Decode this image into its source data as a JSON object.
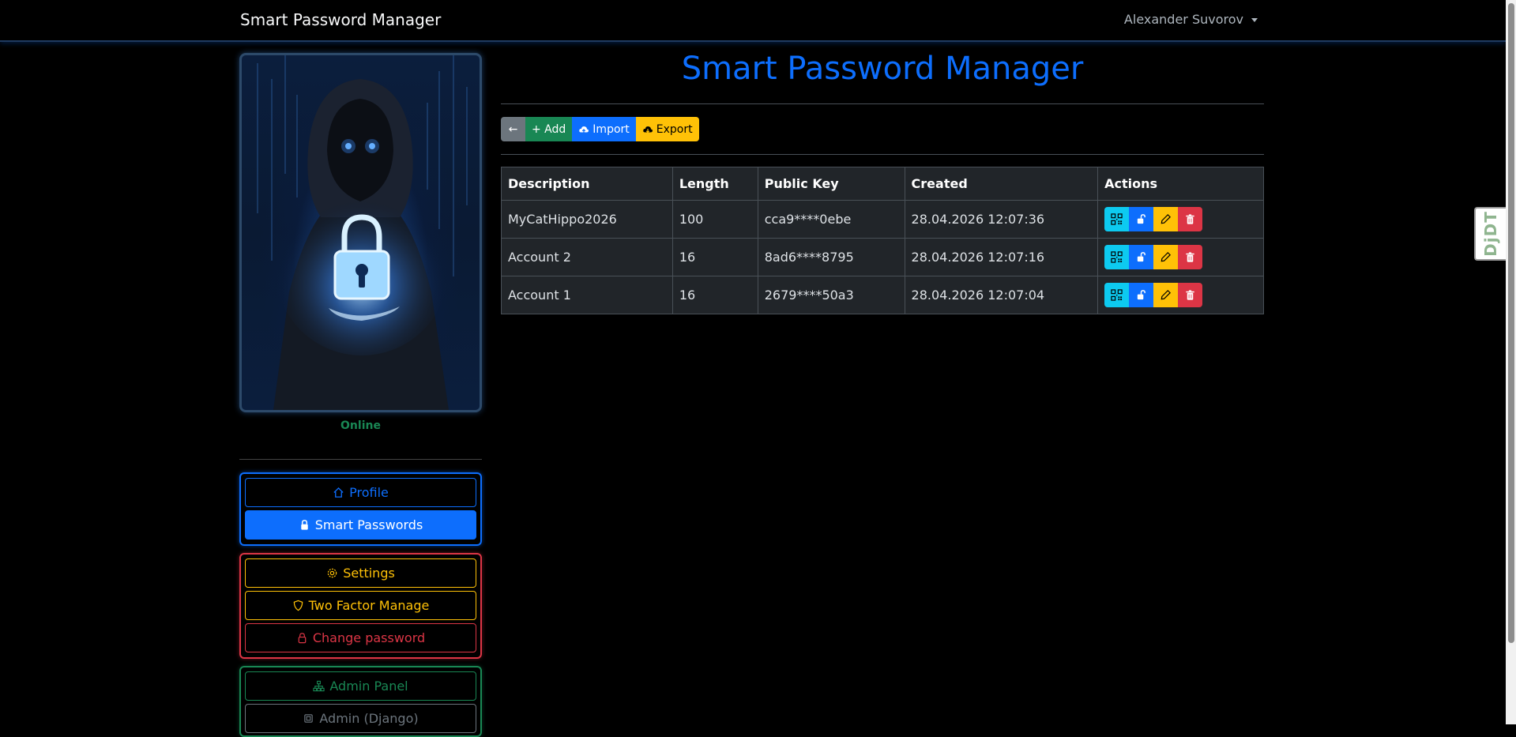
{
  "navbar": {
    "brand": "Smart Password Manager",
    "user_name": "Alexander Suvorov"
  },
  "debug_toolbar": {
    "label": "DjDT"
  },
  "sidebar": {
    "status": "Online",
    "status_color": "#198754",
    "groups": [
      {
        "items": [
          {
            "label": "Profile",
            "icon": "house-icon",
            "style": "outline-primary"
          },
          {
            "label": "Smart Passwords",
            "icon": "lock-icon",
            "style": "primary",
            "active": true
          }
        ]
      },
      {
        "items": [
          {
            "label": "Settings",
            "icon": "gear-icon",
            "style": "outline-warning"
          },
          {
            "label": "Two Factor Manage",
            "icon": "shield-icon",
            "style": "outline-warning"
          },
          {
            "label": "Change password",
            "icon": "lock-icon",
            "style": "outline-danger"
          }
        ]
      },
      {
        "items": [
          {
            "label": "Admin Panel",
            "icon": "diagram-icon",
            "style": "outline-success"
          },
          {
            "label": "Admin (Django)",
            "icon": "cpu-icon",
            "style": "outline-secondary"
          }
        ]
      }
    ]
  },
  "main": {
    "title": "Smart Password Manager",
    "toolbar": {
      "back_label": "←",
      "add_label": "+ Add",
      "import_label": "Import",
      "export_label": "Export"
    },
    "table": {
      "columns": [
        "Description",
        "Length",
        "Public Key",
        "Created",
        "Actions"
      ],
      "rows": [
        {
          "description": "MyCatHippo2026",
          "length": "100",
          "public_key": "cca9****0ebe",
          "created": "28.04.2026 12:07:36"
        },
        {
          "description": "Account 2",
          "length": "16",
          "public_key": "8ad6****8795",
          "created": "28.04.2026 12:07:16"
        },
        {
          "description": "Account 1",
          "length": "16",
          "public_key": "2679****50a3",
          "created": "28.04.2026 12:07:04"
        }
      ],
      "row_actions": [
        "qr-code-icon",
        "unlock-icon",
        "pencil-icon",
        "trash-icon"
      ]
    }
  },
  "colors": {
    "primary": "#0d6efd",
    "success": "#198754",
    "warning": "#ffc107",
    "danger": "#dc3545",
    "info": "#0dcaf0",
    "secondary": "#6c757d",
    "table_bg": "#212529"
  }
}
